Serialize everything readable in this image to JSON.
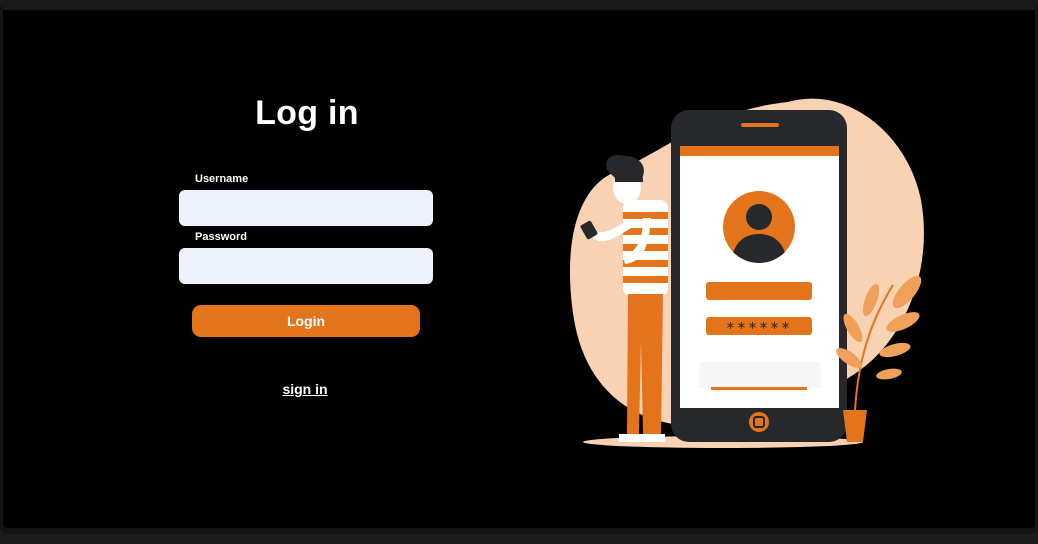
{
  "login_form": {
    "title": "Log in",
    "username_label": "Username",
    "username_value": "",
    "password_label": "Password",
    "password_value": "",
    "login_button": "Login",
    "signin_link": "sign in"
  },
  "illustration": {
    "password_mask": "******",
    "icon_names": [
      "user-avatar-icon",
      "home-button-icon",
      "plant-icon"
    ]
  },
  "colors": {
    "background": "#000000",
    "accent": "#e4741c",
    "blob": "#f8d2b2",
    "input_bg": "#eef3fb",
    "phone_body": "#26282c"
  }
}
